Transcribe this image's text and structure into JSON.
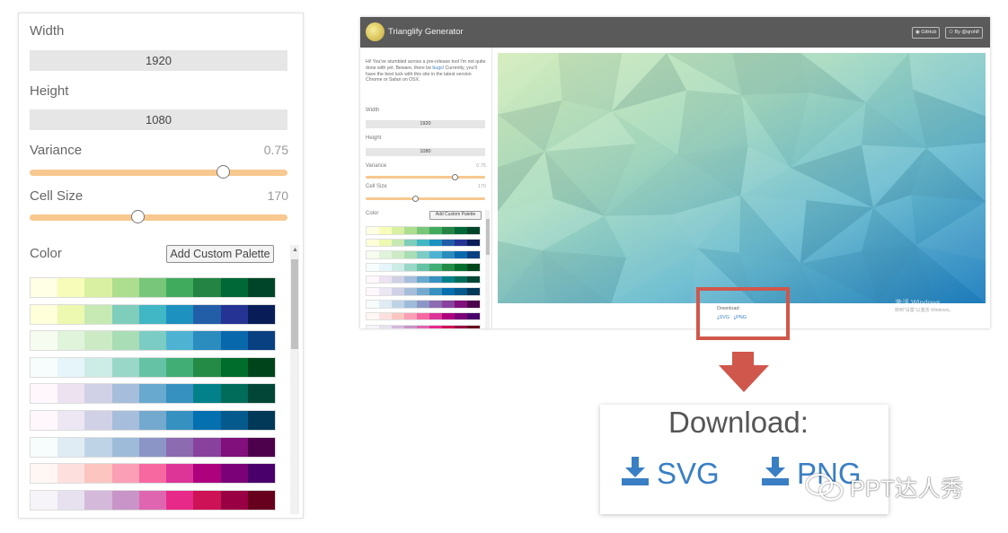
{
  "left_panel": {
    "width_label": "Width",
    "width_value": "1920",
    "height_label": "Height",
    "height_value": "1080",
    "variance_label": "Variance",
    "variance_value": "0.75",
    "cellsize_label": "Cell Size",
    "cellsize_value": "170",
    "color_label": "Color",
    "add_palette_button": "Add Custom Palette"
  },
  "app": {
    "title": "Trianglify Generator",
    "github_button": "GitHub",
    "by_button": "By @qrohlf",
    "intro_prefix": "Hi! You've stumbled across a pre-release tool I'm not quite done with yet. Beware, there be",
    "intro_link": "bugs",
    "intro_suffix": "! Currently, you'll have the best luck with this site in the latest version Chrome or Safari on OSX.",
    "width_label": "Width",
    "width_value": "1920",
    "height_label": "Height",
    "height_value": "1080",
    "variance_label": "Variance",
    "variance_value": "0.75",
    "cellsize_label": "Cell Size",
    "cellsize_value": "170",
    "color_label": "Color",
    "add_palette_button": "Add Custom Palette",
    "download_label": "Download:",
    "svg_link": "SVG",
    "png_link": "PNG",
    "watermark_line1": "激活 Windows",
    "watermark_line2": "转到\"设置\"以激活 Windows。"
  },
  "zoom_download": {
    "title": "Download:",
    "svg_link": "SVG",
    "png_link": "PNG"
  },
  "watermark": {
    "text": "PPT达人秀"
  },
  "sliders": {
    "variance_fraction": 0.75,
    "cellsize_fraction": 0.42
  },
  "palettes": [
    [
      "#ffffe5",
      "#f7fcb9",
      "#d9f0a3",
      "#addd8e",
      "#78c679",
      "#41ab5d",
      "#238443",
      "#006837",
      "#004529"
    ],
    [
      "#ffffd9",
      "#edf8b1",
      "#c7e9b4",
      "#7fcdbb",
      "#41b6c4",
      "#1d91c0",
      "#225ea8",
      "#253494",
      "#081d58"
    ],
    [
      "#f7fcf0",
      "#e0f3db",
      "#ccebc5",
      "#a8ddb5",
      "#7bccc4",
      "#4eb3d3",
      "#2b8cbe",
      "#0868ac",
      "#084081"
    ],
    [
      "#f7fcfd",
      "#e5f5f9",
      "#ccece6",
      "#99d8c9",
      "#66c2a4",
      "#41ae76",
      "#238b45",
      "#006d2c",
      "#00441b"
    ],
    [
      "#fff7fb",
      "#ece2f0",
      "#d0d1e6",
      "#a6bddb",
      "#67a9cf",
      "#3690c0",
      "#02818a",
      "#016c59",
      "#014636"
    ],
    [
      "#fff7fb",
      "#ece7f2",
      "#d0d1e6",
      "#a6bddb",
      "#74a9cf",
      "#3690c0",
      "#0570b0",
      "#045a8d",
      "#023858"
    ],
    [
      "#f7fcfd",
      "#e0ecf4",
      "#bfd3e6",
      "#9ebcda",
      "#8c96c6",
      "#8c6bb1",
      "#88419d",
      "#810f7c",
      "#4d004b"
    ],
    [
      "#fff7f3",
      "#fde0dd",
      "#fcc5c0",
      "#fa9fb5",
      "#f768a1",
      "#dd3497",
      "#ae017e",
      "#7a0177",
      "#49006a"
    ],
    [
      "#f7f4f9",
      "#e7e1ef",
      "#d4b9da",
      "#c994c7",
      "#df65b0",
      "#e7298a",
      "#ce1256",
      "#980043",
      "#67001f"
    ],
    [
      "#fff5eb",
      "#fee6ce",
      "#fdd0a2",
      "#fdae6b",
      "#fd8d3c",
      "#f16913",
      "#d94801",
      "#a63603",
      "#7f2704"
    ]
  ],
  "colors": {
    "accent": "#3a7fc4",
    "slider": "#f7c88f",
    "callout": "#d0574b",
    "header": "#5a5a5a"
  }
}
